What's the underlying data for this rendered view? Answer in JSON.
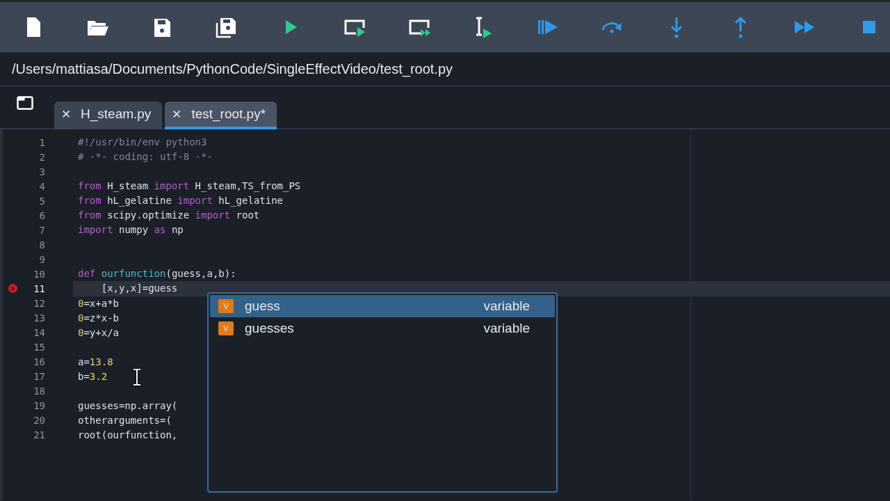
{
  "path": "/Users/mattiasa/Documents/PythonCode/SingleEffectVideo/test_root.py",
  "tabs": [
    {
      "label": "H_steam.py",
      "close": "✕",
      "selected": false
    },
    {
      "label": "test_root.py*",
      "close": "✕",
      "selected": true
    }
  ],
  "editor": {
    "lines": [
      {
        "number": "1",
        "current": false,
        "error": false,
        "tokens": [
          {
            "kind": "comment",
            "text": "#!/usr/bin/env python3"
          }
        ]
      },
      {
        "number": "2",
        "current": false,
        "error": false,
        "tokens": [
          {
            "kind": "comment",
            "text": "# -*- coding: utf-8 -*-"
          }
        ]
      },
      {
        "number": "3",
        "current": false,
        "error": false
      },
      {
        "number": "4",
        "current": false,
        "error": false,
        "tokens": [
          {
            "kind": "keyword",
            "text": "from"
          },
          {
            "kind": "plain",
            "text": " H_steam "
          },
          {
            "kind": "keyword",
            "text": "import"
          },
          {
            "kind": "plain",
            "text": " H_steam,TS_from_PS"
          }
        ]
      },
      {
        "number": "5",
        "current": false,
        "error": false,
        "tokens": [
          {
            "kind": "keyword",
            "text": "from"
          },
          {
            "kind": "plain",
            "text": " hL_gelatine "
          },
          {
            "kind": "keyword",
            "text": "import"
          },
          {
            "kind": "plain",
            "text": " hL_gelatine"
          }
        ]
      },
      {
        "number": "6",
        "current": false,
        "error": false,
        "tokens": [
          {
            "kind": "keyword",
            "text": "from"
          },
          {
            "kind": "plain",
            "text": " scipy.optimize "
          },
          {
            "kind": "keyword",
            "text": "import"
          },
          {
            "kind": "plain",
            "text": " root"
          }
        ]
      },
      {
        "number": "7",
        "current": false,
        "error": false,
        "tokens": [
          {
            "kind": "keyword",
            "text": "import"
          },
          {
            "kind": "plain",
            "text": " numpy "
          },
          {
            "kind": "keyword",
            "text": "as"
          },
          {
            "kind": "plain",
            "text": " np"
          }
        ]
      },
      {
        "number": "8",
        "current": false,
        "error": false
      },
      {
        "number": "9",
        "current": false,
        "error": false
      },
      {
        "number": "10",
        "current": false,
        "error": false,
        "tokens": [
          {
            "kind": "keyword",
            "text": "def"
          },
          {
            "kind": "function",
            "text": " ourfunction"
          },
          {
            "kind": "plain",
            "text": "(guess,a,b):"
          }
        ]
      },
      {
        "number": "11",
        "current": true,
        "error": true,
        "tokens": [
          {
            "kind": "plain",
            "text": "    [x,y,x]=guess"
          }
        ]
      },
      {
        "number": "12",
        "current": false,
        "error": false,
        "tokens": [
          {
            "kind": "number",
            "text": "0"
          },
          {
            "kind": "plain",
            "text": "=x+a*b"
          }
        ]
      },
      {
        "number": "13",
        "current": false,
        "error": false,
        "tokens": [
          {
            "kind": "number",
            "text": "0"
          },
          {
            "kind": "plain",
            "text": "=z*x-b"
          }
        ]
      },
      {
        "number": "14",
        "current": false,
        "error": false,
        "tokens": [
          {
            "kind": "number",
            "text": "0"
          },
          {
            "kind": "plain",
            "text": "=y+x/a"
          }
        ]
      },
      {
        "number": "15",
        "current": false,
        "error": false
      },
      {
        "number": "16",
        "current": false,
        "error": false,
        "tokens": [
          {
            "kind": "plain",
            "text": "a="
          },
          {
            "kind": "number",
            "text": "13.8"
          }
        ]
      },
      {
        "number": "17",
        "current": false,
        "error": false,
        "tokens": [
          {
            "kind": "plain",
            "text": "b="
          },
          {
            "kind": "number",
            "text": "3.2"
          }
        ]
      },
      {
        "number": "18",
        "current": false,
        "error": false
      },
      {
        "number": "19",
        "current": false,
        "error": false,
        "tokens": [
          {
            "kind": "plain",
            "text": "guesses=np.array("
          }
        ]
      },
      {
        "number": "20",
        "current": false,
        "error": false,
        "tokens": [
          {
            "kind": "plain",
            "text": "otherarguments=("
          }
        ]
      },
      {
        "number": "21",
        "current": false,
        "error": false,
        "tokens": [
          {
            "kind": "plain",
            "text": "root(ourfunction,"
          }
        ]
      }
    ]
  },
  "autocomplete": {
    "items": [
      {
        "badge": "V",
        "label": "guess",
        "type": "variable",
        "selected": true
      },
      {
        "badge": "V",
        "label": "guesses",
        "type": "variable",
        "selected": false
      }
    ]
  }
}
